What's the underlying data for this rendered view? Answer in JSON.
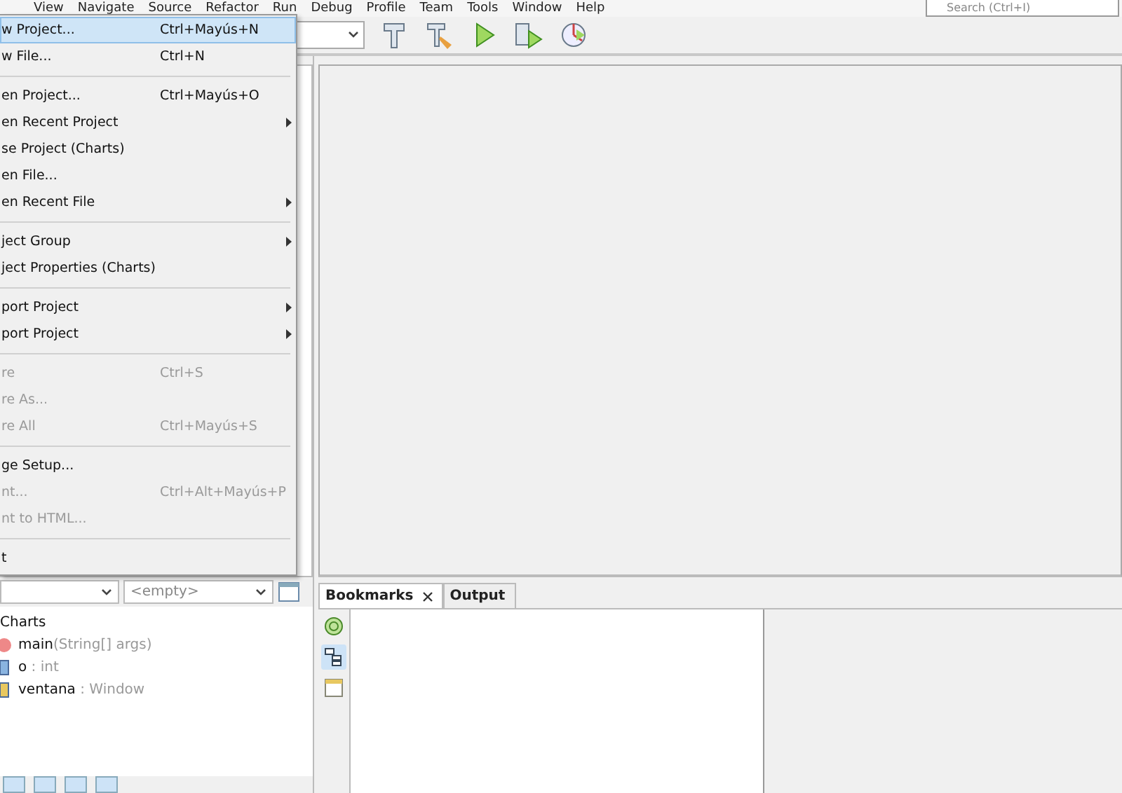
{
  "menubar": [
    {
      "label": "View"
    },
    {
      "label": "Navigate"
    },
    {
      "label": "Source"
    },
    {
      "label": "Refactor"
    },
    {
      "label": "Run"
    },
    {
      "label": "Debug"
    },
    {
      "label": "Profile"
    },
    {
      "label": "Team"
    },
    {
      "label": "Tools"
    },
    {
      "label": "Window"
    },
    {
      "label": "Help"
    }
  ],
  "search": {
    "placeholder": "Search (Ctrl+I)"
  },
  "file_menu": [
    {
      "kind": "item",
      "label": "w Project...",
      "shortcut": "Ctrl+Mayús+N",
      "submenu": false,
      "disabled": false,
      "selected": true
    },
    {
      "kind": "item",
      "label": "w File...",
      "shortcut": "Ctrl+N",
      "submenu": false,
      "disabled": false,
      "selected": false
    },
    {
      "kind": "separator"
    },
    {
      "kind": "item",
      "label": "en Project...",
      "shortcut": "Ctrl+Mayús+O",
      "submenu": false,
      "disabled": false,
      "selected": false
    },
    {
      "kind": "item",
      "label": "en Recent Project",
      "submenu": true,
      "disabled": false,
      "selected": false
    },
    {
      "kind": "item",
      "label": "se Project (Charts)",
      "submenu": false,
      "disabled": false,
      "selected": false
    },
    {
      "kind": "item",
      "label": "en File...",
      "submenu": false,
      "disabled": false,
      "selected": false
    },
    {
      "kind": "item",
      "label": "en Recent File",
      "submenu": true,
      "disabled": false,
      "selected": false
    },
    {
      "kind": "separator"
    },
    {
      "kind": "item",
      "label": "ject Group",
      "submenu": true,
      "disabled": false,
      "selected": false
    },
    {
      "kind": "item",
      "label": "ject Properties (Charts)",
      "submenu": false,
      "disabled": false,
      "selected": false
    },
    {
      "kind": "separator"
    },
    {
      "kind": "item",
      "label": "port Project",
      "submenu": true,
      "disabled": false,
      "selected": false
    },
    {
      "kind": "item",
      "label": "port Project",
      "submenu": true,
      "disabled": false,
      "selected": false
    },
    {
      "kind": "separator"
    },
    {
      "kind": "item",
      "label": "re",
      "shortcut": "Ctrl+S",
      "submenu": false,
      "disabled": true,
      "selected": false
    },
    {
      "kind": "item",
      "label": "re As...",
      "submenu": false,
      "disabled": true,
      "selected": false
    },
    {
      "kind": "item",
      "label": "re All",
      "shortcut": "Ctrl+Mayús+S",
      "submenu": false,
      "disabled": true,
      "selected": false
    },
    {
      "kind": "separator"
    },
    {
      "kind": "item",
      "label": "ge Setup...",
      "submenu": false,
      "disabled": false,
      "selected": false
    },
    {
      "kind": "item",
      "label": "nt...",
      "shortcut": "Ctrl+Alt+Mayús+P",
      "submenu": false,
      "disabled": true,
      "selected": false
    },
    {
      "kind": "item",
      "label": "nt to HTML...",
      "submenu": false,
      "disabled": true,
      "selected": false
    },
    {
      "kind": "separator"
    },
    {
      "kind": "item",
      "label": "t",
      "submenu": false,
      "disabled": false,
      "selected": false
    }
  ],
  "navigator": {
    "member_filter": "<empty>",
    "tree": {
      "label": "Charts",
      "children": [
        {
          "kind": "method",
          "name": "main",
          "detail": "(String[] args)"
        },
        {
          "kind": "field",
          "name": "o",
          "detail": " : int"
        },
        {
          "kind": "object",
          "name": "ventana",
          "detail": " : Window"
        }
      ]
    }
  },
  "output": {
    "tabs": [
      {
        "label": "Bookmarks",
        "selected": true,
        "closable": true
      },
      {
        "label": "Output",
        "selected": false,
        "closable": false
      }
    ]
  }
}
